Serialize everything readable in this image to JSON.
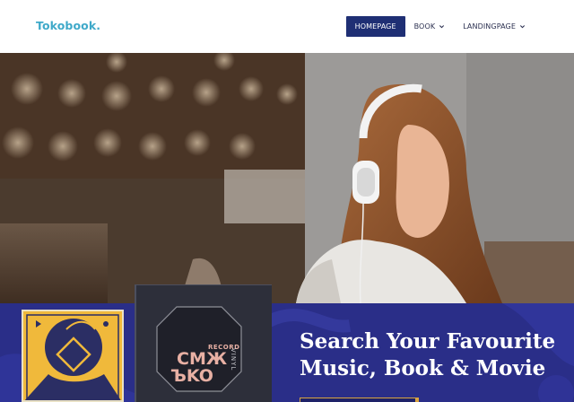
{
  "header": {
    "logo": "Tokobook.",
    "nav": [
      {
        "label": "HOMEPAGE",
        "active": true,
        "dropdown": false
      },
      {
        "label": "BOOK",
        "active": false,
        "dropdown": true
      },
      {
        "label": "LANDINGPAGE",
        "active": false,
        "dropdown": true
      }
    ]
  },
  "hero": {
    "image": "woman-with-headphones-reading-photo"
  },
  "promo": {
    "headline_line1": "Search Your Favourite",
    "headline_line2": "Music, Book & Movie",
    "vinyl_label_top": "RECORD",
    "vinyl_label_side": "VINYL",
    "vinyl_logo_top": "CMЖ",
    "vinyl_logo_bottom": "ЪKO"
  },
  "colors": {
    "brand": "#3fa9c9",
    "nav_active": "#1f2f74",
    "band": "#2a2e88",
    "accent": "#d9a441"
  }
}
